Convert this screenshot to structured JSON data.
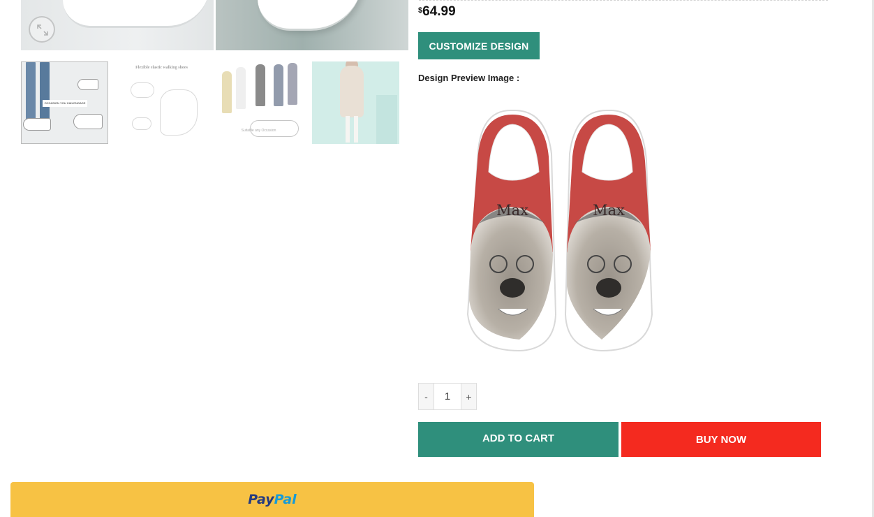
{
  "gallery": {
    "zoom_icon": "expand-arrows-icon",
    "thumbnails": [
      {
        "caption": "OCCASION YOU CAN ENGAGE"
      },
      {
        "caption": "Flexible elastic walking shoes"
      },
      {
        "caption": "Suitable any Occasion"
      },
      {
        "caption": ""
      }
    ]
  },
  "product": {
    "currency_symbol": "$",
    "price": "64.99",
    "customize_label": "CUSTOMIZE DESIGN",
    "preview_label": "Design Preview Image :",
    "preview_name_left": "Max",
    "preview_name_right": "Max",
    "quantity": "1",
    "qty_minus": "-",
    "qty_plus": "+",
    "add_to_cart_label": "ADD TO CART",
    "buy_now_label": "BUY NOW",
    "paypal_part1": "Pay",
    "paypal_part2": "Pal"
  },
  "colors": {
    "primary": "#2f8f7c",
    "buy_now": "#f42a1f",
    "paypal": "#f7c244",
    "shoe_red": "#c23a35"
  }
}
